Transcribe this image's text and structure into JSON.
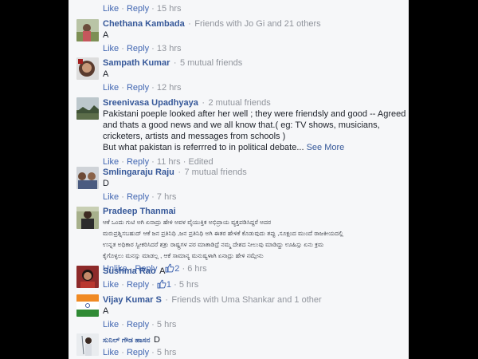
{
  "actions": {
    "like": "Like",
    "reply": "Reply",
    "unlike": "Unlike",
    "see_more": "See More",
    "sep": "·"
  },
  "top": {
    "time": "15 hrs"
  },
  "comments": [
    {
      "author": "Chethana Kambada",
      "relation": "Friends with Jo Gi and 21 others",
      "text": [
        "A"
      ],
      "time": "13 hrs"
    },
    {
      "author": "Sampath Kumar",
      "relation": "5 mutual friends",
      "text": [
        "A"
      ],
      "time": "12 hrs"
    },
    {
      "author": "Sreenivasa Upadhyaya",
      "relation": "2 mutual friends",
      "text": [
        "Pakistani poeple looked after her well ; they were friendsly and good -- Agreed",
        "and thats a good news and we all know that.( eg: TV shows, musicians,",
        "cricketers, artists and messages from schools )",
        "But what pakistan is referrred to in political debate..."
      ],
      "time": "11 hrs",
      "edited": "Edited"
    },
    {
      "author": "Smlingaraju Raju",
      "relation": "7 mutual friends",
      "text": [
        "D"
      ],
      "time": "7 hrs"
    },
    {
      "author": "Pradeep Thanmai",
      "text": [
        "ಆಕೆ ಒಂದು ಗುಟಿ ಅಗಿ ಏನಾದ್ರು ಹೇಳಿ ಅವಳ ವೈಯುಕ್ತಿಕ ಅಭಿಪ್ರಾಯ ವ್ಯಕ್ತಪಡಿಸಿದ್ದರೆ ಅದರ",
        "ಮರುಪ್ರಶ್ನಿಸಬಹುದ್ ಆಕೆ ಜನ ಪ್ರತಿನಿಧಿ ,ಜನ ಪ್ರತಿನಿಧಿ ಅಗಿ ಈತರ ಹೇಳಿಕೆ ಕೊಡುವುದು ತಪ್ಪು ,ಸೂಕ್ಷಂದ ಮುಂದೆ ರಾಜಕೀಯದಲ್ಲಿ",
        "ಉನ್ನತ ಅಧಿಕಾರ ಸ್ವೀಕರಿಸಿದರೆ ಶತ್ರು ರಾಷ್ಟ್ರಗಳ ಪರ ಮಾತಾಡಿದ್ರೆ ನಮ್ಮ ದೇಶದ ನೀಲುವು ಮಾಡಿದ್ದು ಊಹಿಸ್ಸು ಏನು ಕ್ರಮ",
        "ಕೈಗೊಳ್ಳಲು ಮನಸ್ಸು ಮಾಡಲ್ಲ , ಆಕೆ ಸಾಮಾನ್ಯ ಮನುಷ್ಯಳಾಗಿ ಏನಾದ್ರು ಹೇಳಿ ನಮ್ಗೇನು"
      ],
      "time": "6 hrs",
      "likes": "2"
    },
    {
      "author": "Sushma Rao",
      "text_inline": "A",
      "time": "5 hrs",
      "likes": "1"
    },
    {
      "author": "Vijay Kumar S",
      "relation": "Friends with Uma Shankar and 1 other",
      "text": [
        "A"
      ],
      "time": "5 hrs"
    },
    {
      "author": "ಸುನಿಲ್ ಗೌಡ ಹಾಸನ",
      "text_inline": "D",
      "time": "5 hrs"
    }
  ],
  "icons": {
    "like": "thumbs-up-icon"
  },
  "colors": {
    "link": "#365899",
    "action": "#4267b2",
    "meta": "#90949c",
    "panel": "#f6f7f9"
  }
}
